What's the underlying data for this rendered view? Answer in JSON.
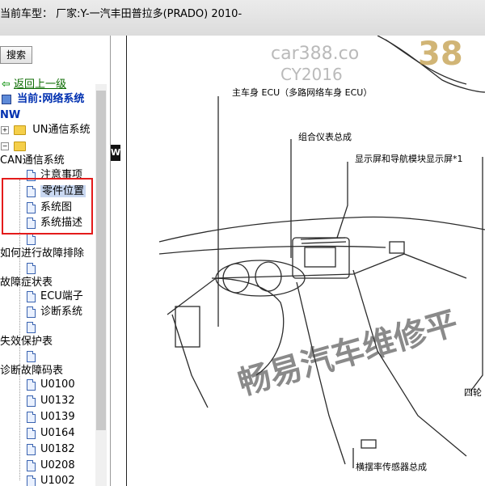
{
  "window": {
    "title": "当前车型： 厂家:Y-一汽丰田普拉多(PRADO) 2010-"
  },
  "sidebar": {
    "search_label": "搜索",
    "back_link": "返回上一级",
    "current_label": "当前:网络系统",
    "root": "NW",
    "items": [
      {
        "label": "UN通信系统",
        "kind": "folder"
      },
      {
        "label": "",
        "kind": "folder"
      },
      {
        "label": "CAN通信系统",
        "kind": "text"
      },
      {
        "label": "注意事项",
        "kind": "doc"
      },
      {
        "label": "零件位置",
        "kind": "doc",
        "selected": true
      },
      {
        "label": "系统图",
        "kind": "doc"
      },
      {
        "label": "系统描述",
        "kind": "doc"
      },
      {
        "label": "",
        "kind": "doc"
      },
      {
        "label": "如何进行故障排除",
        "kind": "text"
      },
      {
        "label": "",
        "kind": "doc"
      },
      {
        "label": "故障症状表",
        "kind": "text"
      },
      {
        "label": "ECU端子",
        "kind": "doc"
      },
      {
        "label": "诊断系统",
        "kind": "doc"
      },
      {
        "label": "",
        "kind": "doc"
      },
      {
        "label": "失效保护表",
        "kind": "text"
      },
      {
        "label": "",
        "kind": "doc"
      },
      {
        "label": "诊断故障码表",
        "kind": "text"
      },
      {
        "label": "U0100",
        "kind": "doc"
      },
      {
        "label": "U0132",
        "kind": "doc"
      },
      {
        "label": "U0139",
        "kind": "doc"
      },
      {
        "label": "U0164",
        "kind": "doc"
      },
      {
        "label": "U0182",
        "kind": "doc"
      },
      {
        "label": "U0208",
        "kind": "doc"
      },
      {
        "label": "U1002",
        "kind": "doc"
      }
    ]
  },
  "content": {
    "marker": "W",
    "callouts": {
      "main_body_ecu": "主车身 ECU（多路网络车身 ECU）",
      "combination_meter": "组合仪表总成",
      "display": "显示屏和导航模块显示屏*1",
      "four_wheel": "四轮",
      "yaw_rate_sensor": "横摆率传感器总成"
    },
    "watermarks": {
      "site": "car388.co",
      "site_code": "CY2016",
      "logo_num": "38",
      "company": "畅易汽车维修平"
    }
  },
  "colors": {
    "highlight_box": "#e41b1b",
    "link": "#0b6b00",
    "current": "#0030b0"
  }
}
